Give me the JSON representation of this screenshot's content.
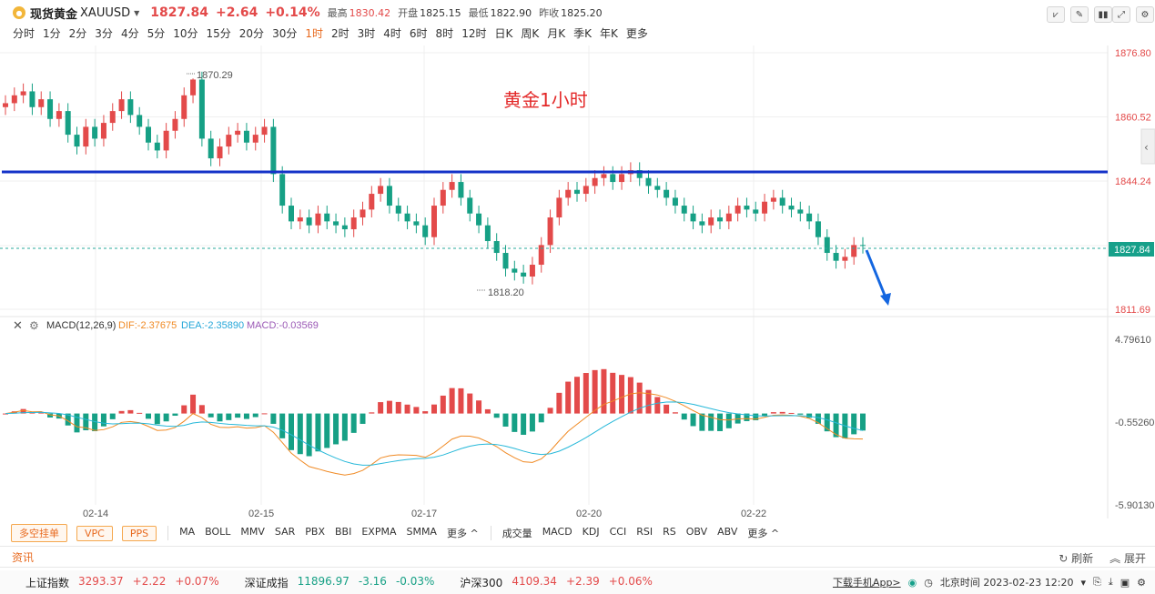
{
  "header": {
    "symbol_name": "现货黄金",
    "symbol_code": "XAUUSD",
    "price": "1827.84",
    "change": "+2.64",
    "change_pct": "+0.14%",
    "high_label": "最高",
    "high": "1830.42",
    "open_label": "开盘",
    "open": "1825.15",
    "low_label": "最低",
    "low": "1822.90",
    "prev_label": "昨收",
    "prev_close": "1825.20"
  },
  "periods": [
    "分时",
    "1分",
    "2分",
    "3分",
    "4分",
    "5分",
    "10分",
    "15分",
    "20分",
    "30分",
    "1时",
    "2时",
    "3时",
    "4时",
    "6时",
    "8时",
    "12时",
    "日K",
    "周K",
    "月K",
    "季K",
    "年K",
    "更多"
  ],
  "active_period": "1时",
  "chart": {
    "annotation": "黄金1小时",
    "high_label": "1870.29",
    "low_label": "1818.20",
    "price_axis": [
      "1876.80",
      "1860.52",
      "1844.24",
      "1827.84",
      "1811.69"
    ],
    "current_price_tag": "1827.84",
    "date_ticks": [
      "02-14",
      "02-15",
      "02-17",
      "02-20",
      "02-22"
    ],
    "resistance_level": 1845.0
  },
  "macd": {
    "title": "MACD(12,26,9)",
    "dif_label": "DIF:-2.37675",
    "dea_label": "DEA:-2.35890",
    "macd_label": "MACD:-0.03569",
    "axis": [
      "4.79610",
      "-0.55260",
      "-5.90130"
    ]
  },
  "indicator_bar": {
    "buttons": [
      "多空挂单",
      "VPC",
      "PPS"
    ],
    "main_indicators": [
      "MA",
      "BOLL",
      "MMV",
      "SAR",
      "PBX",
      "BBI",
      "EXPMA",
      "SMMA",
      "更多 ^"
    ],
    "sub_indicators": [
      "成交量",
      "MACD",
      "KDJ",
      "CCI",
      "RSI",
      "RS",
      "OBV",
      "ABV",
      "更多 ^"
    ]
  },
  "news": {
    "label": "资讯",
    "refresh": "刷新",
    "expand": "展开"
  },
  "status_bar": {
    "indices": [
      {
        "name": "上证指数",
        "value": "3293.37",
        "change": "+2.22",
        "pct": "+0.07%",
        "dir": "up"
      },
      {
        "name": "深证成指",
        "value": "11896.97",
        "change": "-3.16",
        "pct": "-0.03%",
        "dir": "down"
      },
      {
        "name": "沪深300",
        "value": "4109.34",
        "change": "+2.39",
        "pct": "+0.06%",
        "dir": "up"
      }
    ],
    "download": "下载手机App>",
    "time": "北京时间 2023-02-23 12:20"
  },
  "colors": {
    "up": "#e34a4a",
    "down": "#16a085",
    "accent": "#e86a1f",
    "line": "#1432c8"
  },
  "chart_data": {
    "type": "candlestick",
    "x_ticks": [
      "02-14",
      "02-15",
      "02-17",
      "02-20",
      "02-22"
    ],
    "ylim": [
      1811.69,
      1876.8
    ],
    "high": 1870.29,
    "low": 1818.2,
    "last": 1827.84,
    "closes": [
      1864,
      1866,
      1867,
      1863,
      1865,
      1860,
      1862,
      1856,
      1853,
      1858,
      1855,
      1859,
      1862,
      1865,
      1861,
      1858,
      1854,
      1852,
      1857,
      1860,
      1866,
      1870,
      1855,
      1850,
      1853,
      1856,
      1857,
      1854,
      1856,
      1858,
      1846,
      1838,
      1834,
      1835,
      1833,
      1836,
      1834,
      1833,
      1832,
      1835,
      1837,
      1841,
      1843,
      1838,
      1836,
      1834,
      1833,
      1830,
      1838,
      1842,
      1844,
      1840,
      1836,
      1833,
      1829,
      1826,
      1822,
      1821,
      1820,
      1823,
      1828,
      1835,
      1840,
      1842,
      1841,
      1843,
      1845,
      1846,
      1844,
      1846,
      1847,
      1845,
      1843,
      1842,
      1840,
      1838,
      1836,
      1834,
      1833,
      1835,
      1834,
      1836,
      1838,
      1837,
      1836,
      1839,
      1840,
      1838,
      1837,
      1836,
      1834,
      1830,
      1826,
      1824,
      1825,
      1828,
      1827.84
    ]
  }
}
